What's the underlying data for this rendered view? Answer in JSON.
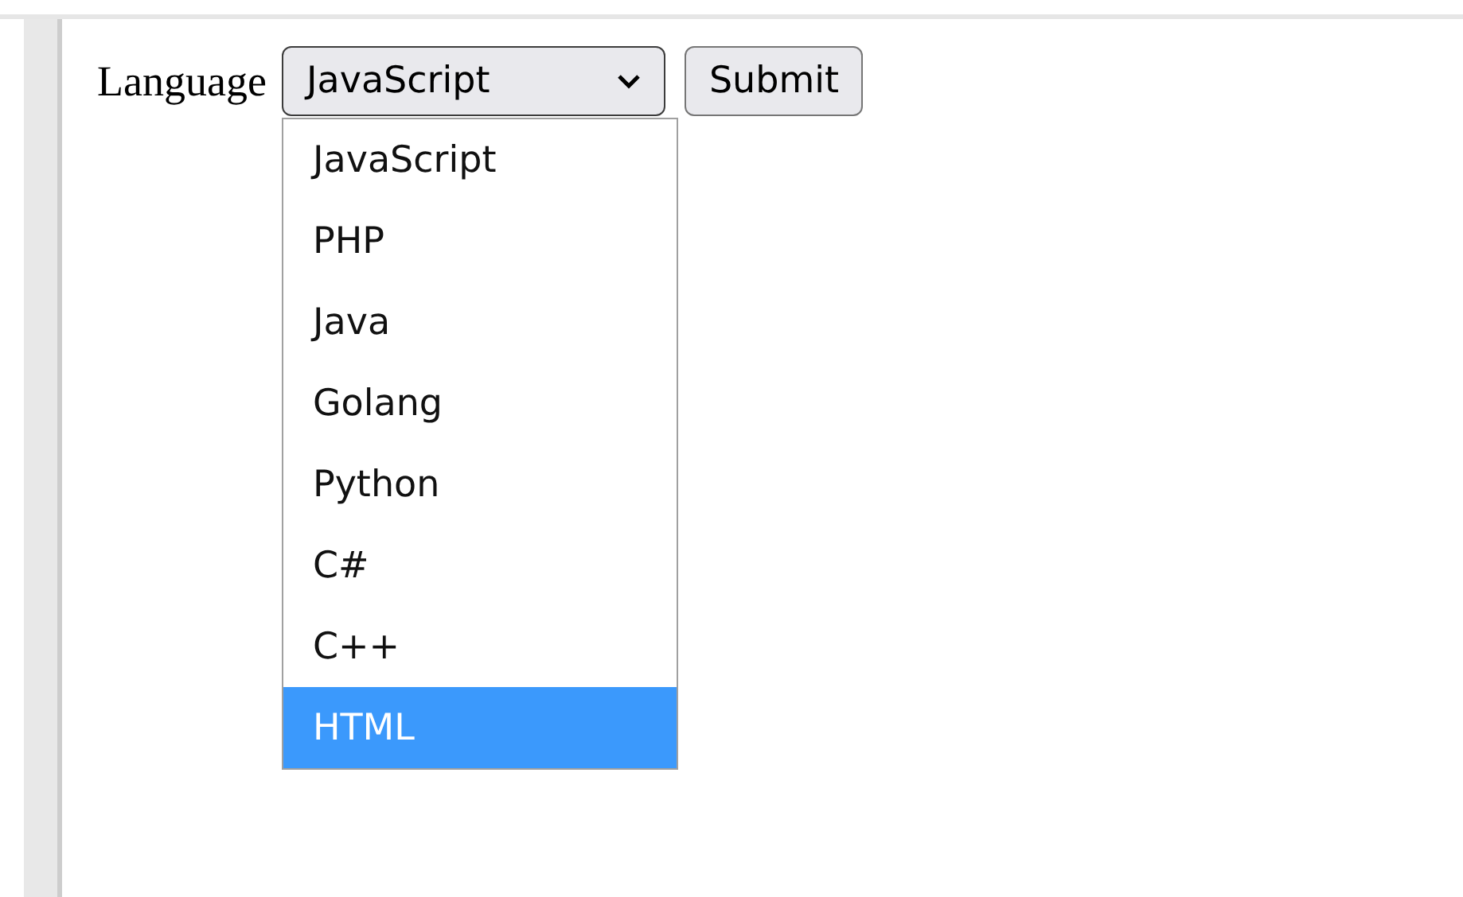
{
  "form": {
    "label": "Language",
    "select": {
      "value": "JavaScript",
      "expanded": true
    },
    "submit": "Submit"
  },
  "options": [
    {
      "label": "JavaScript",
      "selected": false
    },
    {
      "label": "PHP",
      "selected": false
    },
    {
      "label": "Java",
      "selected": false
    },
    {
      "label": "Golang",
      "selected": false
    },
    {
      "label": "Python",
      "selected": false
    },
    {
      "label": "C#",
      "selected": false
    },
    {
      "label": "C++",
      "selected": false
    },
    {
      "label": "HTML",
      "selected": true
    }
  ]
}
